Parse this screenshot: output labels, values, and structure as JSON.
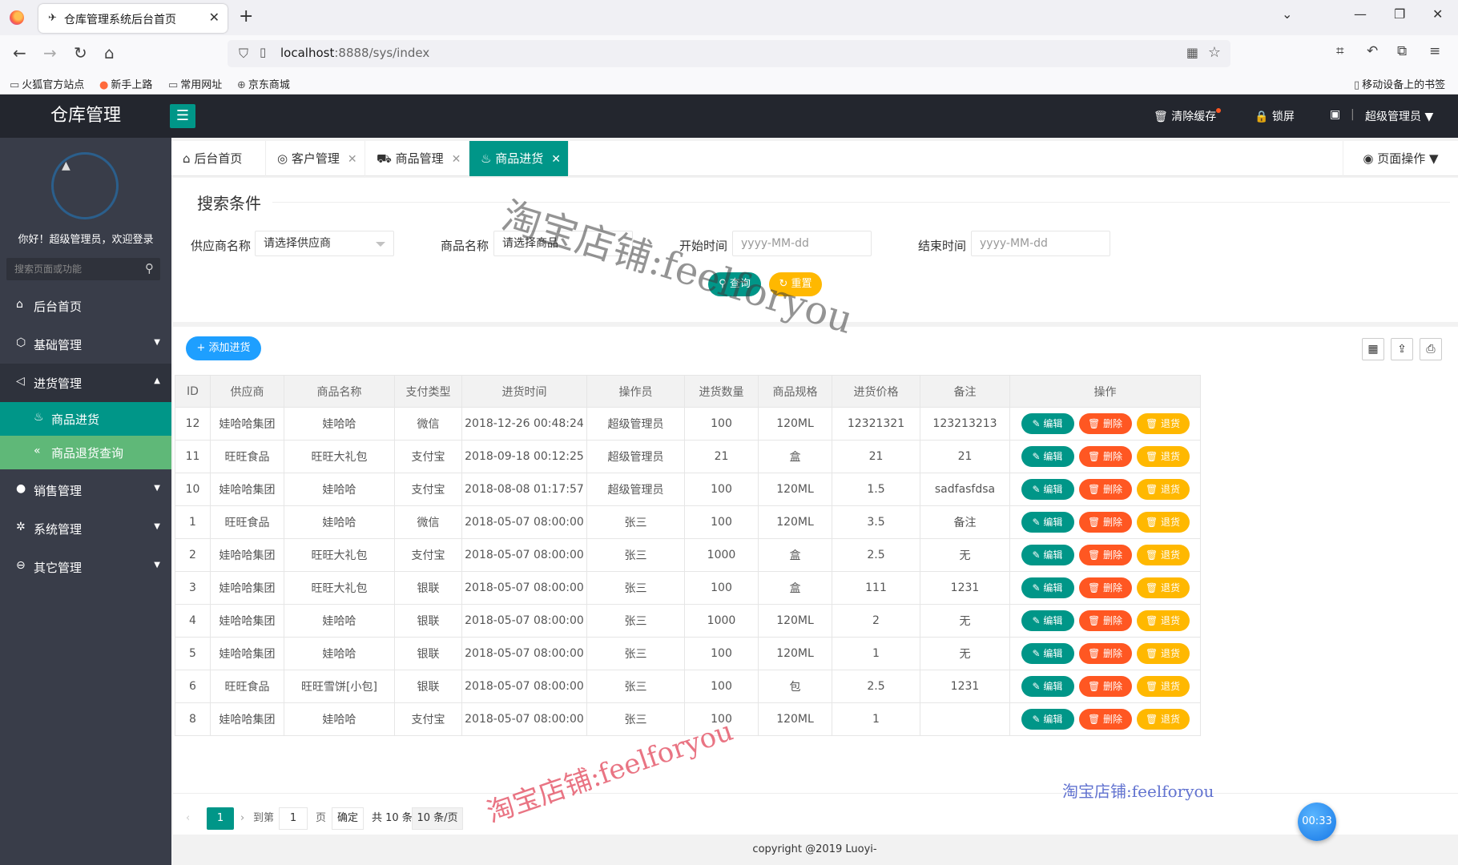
{
  "browser": {
    "tab_title": "仓库管理系统后台首页",
    "url_host": "localhost",
    "url_path": ":8888/sys/index",
    "bookmarks": [
      "火狐官方站点",
      "新手上路",
      "常用网址",
      "京东商城"
    ],
    "mobile_bookmarks": "移动设备上的书签"
  },
  "header": {
    "logo": "仓库管理",
    "clear_cache": "清除缓存",
    "lock_screen": "锁屏",
    "user": "超级管理员"
  },
  "sidebar": {
    "welcome": "你好！超级管理员，欢迎登录",
    "search_placeholder": "搜索页面或功能",
    "items": [
      {
        "label": "后台首页"
      },
      {
        "label": "基础管理"
      },
      {
        "label": "进货管理"
      },
      {
        "label": "销售管理"
      },
      {
        "label": "系统管理"
      },
      {
        "label": "其它管理"
      }
    ],
    "sub_items": [
      {
        "label": "商品进货"
      },
      {
        "label": "商品退货查询"
      }
    ]
  },
  "tabs": [
    {
      "label": "后台首页"
    },
    {
      "label": "客户管理"
    },
    {
      "label": "商品管理"
    },
    {
      "label": "商品进货"
    }
  ],
  "page_ops": "页面操作",
  "search": {
    "title": "搜索条件",
    "supplier_label": "供应商名称",
    "supplier_value": "请选择供应商",
    "goods_label": "商品名称",
    "goods_value": "请选择商品",
    "start_label": "开始时间",
    "start_placeholder": "yyyy-MM-dd",
    "end_label": "结束时间",
    "end_placeholder": "yyyy-MM-dd",
    "query_btn": "查询",
    "reset_btn": "重置"
  },
  "table": {
    "add_btn": "添加进货",
    "headers": [
      "ID",
      "供应商",
      "商品名称",
      "支付类型",
      "进货时间",
      "操作员",
      "进货数量",
      "商品规格",
      "进货价格",
      "备注",
      "操作"
    ],
    "op_labels": {
      "edit": "编辑",
      "delete": "删除",
      "return": "退货"
    },
    "rows": [
      [
        "12",
        "娃哈哈集团",
        "娃哈哈",
        "微信",
        "2018-12-26 00:48:24",
        "超级管理员",
        "100",
        "120ML",
        "12321321",
        "123213213"
      ],
      [
        "11",
        "旺旺食品",
        "旺旺大礼包",
        "支付宝",
        "2018-09-18 00:12:25",
        "超级管理员",
        "21",
        "盒",
        "21",
        "21"
      ],
      [
        "10",
        "娃哈哈集团",
        "娃哈哈",
        "支付宝",
        "2018-08-08 01:17:57",
        "超级管理员",
        "100",
        "120ML",
        "1.5",
        "sadfasfdsa"
      ],
      [
        "1",
        "旺旺食品",
        "娃哈哈",
        "微信",
        "2018-05-07 08:00:00",
        "张三",
        "100",
        "120ML",
        "3.5",
        "备注"
      ],
      [
        "2",
        "娃哈哈集团",
        "旺旺大礼包",
        "支付宝",
        "2018-05-07 08:00:00",
        "张三",
        "1000",
        "盒",
        "2.5",
        "无"
      ],
      [
        "3",
        "娃哈哈集团",
        "旺旺大礼包",
        "银联",
        "2018-05-07 08:00:00",
        "张三",
        "100",
        "盒",
        "111",
        "1231"
      ],
      [
        "4",
        "娃哈哈集团",
        "娃哈哈",
        "银联",
        "2018-05-07 08:00:00",
        "张三",
        "1000",
        "120ML",
        "2",
        "无"
      ],
      [
        "5",
        "娃哈哈集团",
        "娃哈哈",
        "银联",
        "2018-05-07 08:00:00",
        "张三",
        "100",
        "120ML",
        "1",
        "无"
      ],
      [
        "6",
        "旺旺食品",
        "旺旺雪饼[小包]",
        "银联",
        "2018-05-07 08:00:00",
        "张三",
        "100",
        "包",
        "2.5",
        "1231"
      ],
      [
        "8",
        "娃哈哈集团",
        "娃哈哈",
        "支付宝",
        "2018-05-07 08:00:00",
        "张三",
        "100",
        "120ML",
        "1",
        ""
      ]
    ]
  },
  "pager": {
    "current": "1",
    "goto_label": "到第",
    "goto_value": "1",
    "page_unit": "页",
    "confirm": "确定",
    "total": "共 10 条",
    "per_page": "10 条/页"
  },
  "footer": "copyright @2019 Luoyi-",
  "timer": "00:33",
  "watermark": "淘宝店铺:feelforyou",
  "icons": {
    "tab_home": "home-icon",
    "cart": "cart-icon",
    "fire": "fire-icon"
  }
}
